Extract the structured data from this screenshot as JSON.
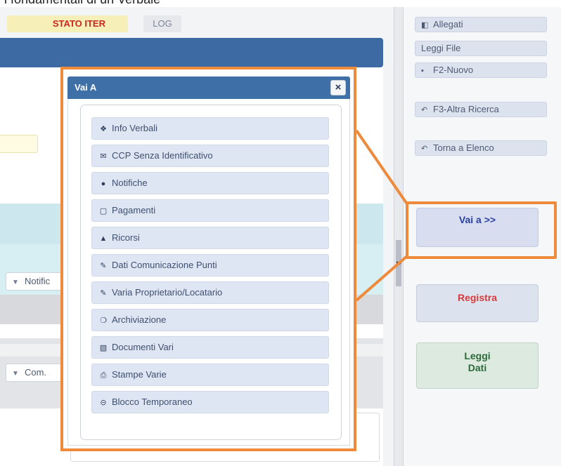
{
  "heading": "i fondamentali di un Verbale",
  "tabs": {
    "stato_iter": "STATO ITER",
    "log": "LOG"
  },
  "left_form": {
    "select1": "Notific",
    "select2": "Com."
  },
  "sidebar": {
    "allegati": "Allegati",
    "leggi_file": "Leggi File",
    "nuovo": "F2-Nuovo",
    "altra_ricerca": "F3-Altra Ricerca",
    "torna_elenco": "Torna a Elenco",
    "vai_a": "Vai a >>",
    "registra": "Registra",
    "leggi_dati_line1": "Leggi",
    "leggi_dati_line2": "Dati"
  },
  "modal": {
    "title": "Vai A",
    "close": "×",
    "items": [
      {
        "label": "Info Verbali",
        "icon": "info-icon"
      },
      {
        "label": "CCP Senza Identificativo",
        "icon": "envelope-icon"
      },
      {
        "label": "Notifiche",
        "icon": "alert-icon"
      },
      {
        "label": "Pagamenti",
        "icon": "payment-icon"
      },
      {
        "label": "Ricorsi",
        "icon": "warning-icon"
      },
      {
        "label": "Dati Comunicazione Punti",
        "icon": "pencil-icon"
      },
      {
        "label": "Varia Proprietario/Locatario",
        "icon": "pencil-icon"
      },
      {
        "label": "Archiviazione",
        "icon": "archive-icon"
      },
      {
        "label": "Documenti Vari",
        "icon": "documents-icon"
      },
      {
        "label": "Stampe Varie",
        "icon": "print-icon"
      },
      {
        "label": "Blocco Temporaneo",
        "icon": "block-icon"
      }
    ]
  },
  "colors": {
    "highlight": "#ee8a3c",
    "header_blue": "#3e6fa6",
    "vaia_text": "#2a3fa2",
    "registra_text": "#d73a3a",
    "leggi_text": "#2c6a3a"
  }
}
